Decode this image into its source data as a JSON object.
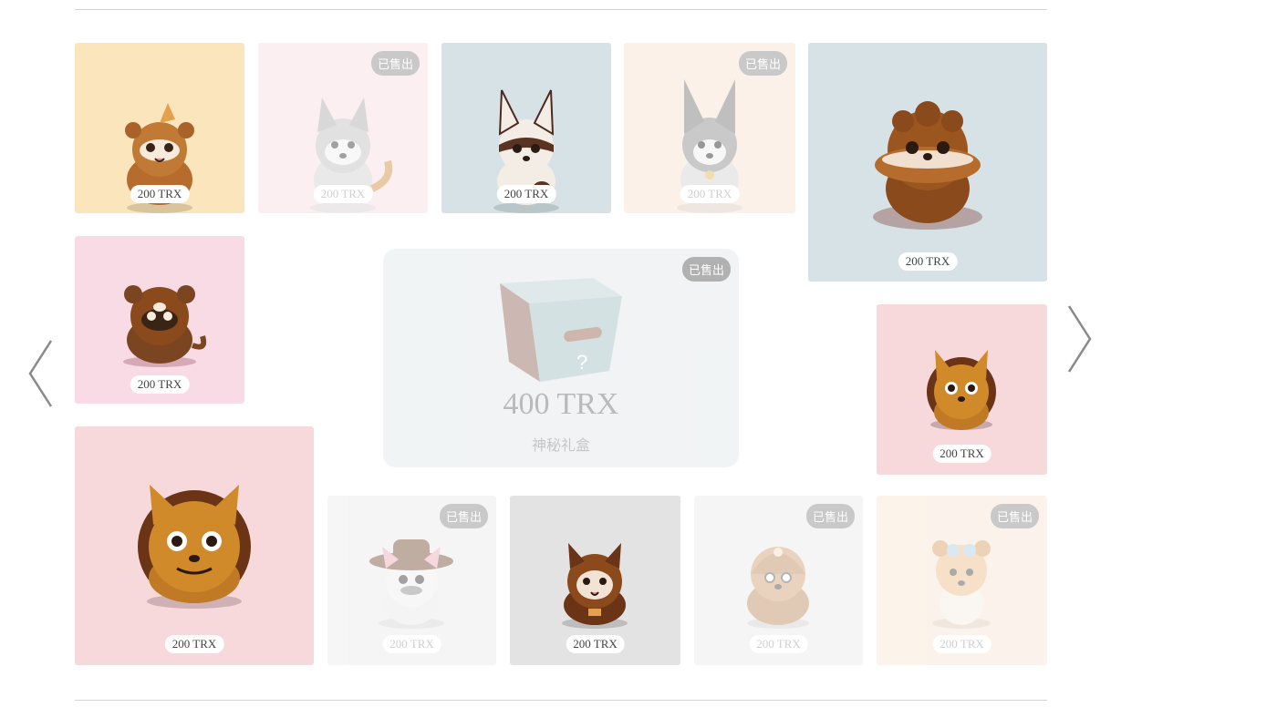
{
  "nav": {
    "prev_icon": "chevron-left-icon",
    "next_icon": "chevron-right-icon"
  },
  "cards": [
    {
      "id": "c1",
      "price": "200 TRX",
      "sold": false,
      "bg": "#fbe5bd"
    },
    {
      "id": "c2",
      "price": "200 TRX",
      "sold": true,
      "bg": "#f9e3e8",
      "badge": "已售出"
    },
    {
      "id": "c3",
      "price": "200 TRX",
      "sold": false,
      "bg": "#d6e2e5"
    },
    {
      "id": "c4",
      "price": "200 TRX",
      "sold": true,
      "bg": "#f9e7d8",
      "badge": "已售出"
    },
    {
      "id": "c5",
      "price": "200 TRX",
      "sold": false,
      "bg": "#d6e2e5"
    },
    {
      "id": "c6",
      "price": "200 TRX",
      "sold": false,
      "bg": "#f8dbe4"
    },
    {
      "id": "c7",
      "price": "200 TRX",
      "sold": false,
      "bg": "#f7d9dc"
    },
    {
      "id": "c8",
      "price": "200 TRX",
      "sold": false,
      "bg": "#f7d9dc"
    },
    {
      "id": "c9",
      "price": "200 TRX",
      "sold": true,
      "bg": "#eeeeee",
      "badge": "已售出"
    },
    {
      "id": "c10",
      "price": "200 TRX",
      "sold": false,
      "bg": "#e3e3e3"
    },
    {
      "id": "c11",
      "price": "200 TRX",
      "sold": true,
      "bg": "#ededed",
      "badge": "已售出"
    },
    {
      "id": "c12",
      "price": "200 TRX",
      "sold": true,
      "bg": "#f9eadb",
      "badge": "已售出"
    }
  ],
  "mystery_box": {
    "price": "400 TRX",
    "label": "神秘礼盒",
    "badge": "已售出",
    "sold": true,
    "bg": "#eef1f2"
  }
}
